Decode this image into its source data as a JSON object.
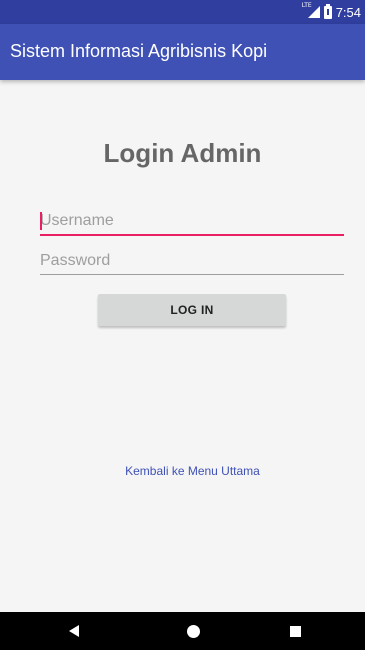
{
  "status_bar": {
    "network": "LTE",
    "time": "7:54",
    "color": "#303f9f"
  },
  "app_bar": {
    "title": "Sistem Informasi Agribisnis Kopi",
    "color": "#3f51b5"
  },
  "login": {
    "heading": "Login Admin",
    "username_placeholder": "Username",
    "username_value": "",
    "password_placeholder": "Password",
    "password_value": "",
    "login_button": "LOG IN",
    "back_link": "Kembali ke Menu Uttama",
    "accent": "#e91e63"
  },
  "nav_bar": {
    "icons": [
      "back-icon",
      "home-icon",
      "recents-icon"
    ]
  }
}
